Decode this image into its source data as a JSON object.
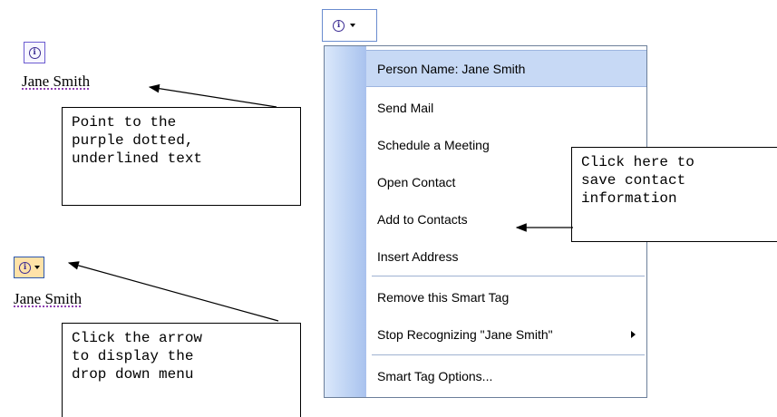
{
  "name_text": "Jane Smith",
  "callouts": {
    "point_to": [
      "Point to the",
      "purple dotted,",
      "underlined text"
    ],
    "click_arrow": [
      "Click the arrow",
      "to display the",
      "drop down menu"
    ],
    "click_here": [
      "Click here to",
      "save contact",
      "information"
    ]
  },
  "icons": {
    "info": "ℹ",
    "smart_tag": "info-icon"
  },
  "menu": {
    "header": "Person Name: Jane Smith",
    "items": [
      "Send Mail",
      "Schedule a Meeting",
      "Open Contact",
      "Add to Contacts",
      "Insert Address",
      "Remove this Smart Tag",
      "Stop Recognizing \"Jane Smith\"",
      "Smart Tag Options..."
    ]
  },
  "colors": {
    "tag_highlight": "#ffe2a8",
    "menu_gutter": "#b7cef2",
    "menu_header": "#c7d9f5",
    "underline_purple": "#7b1fa2"
  }
}
